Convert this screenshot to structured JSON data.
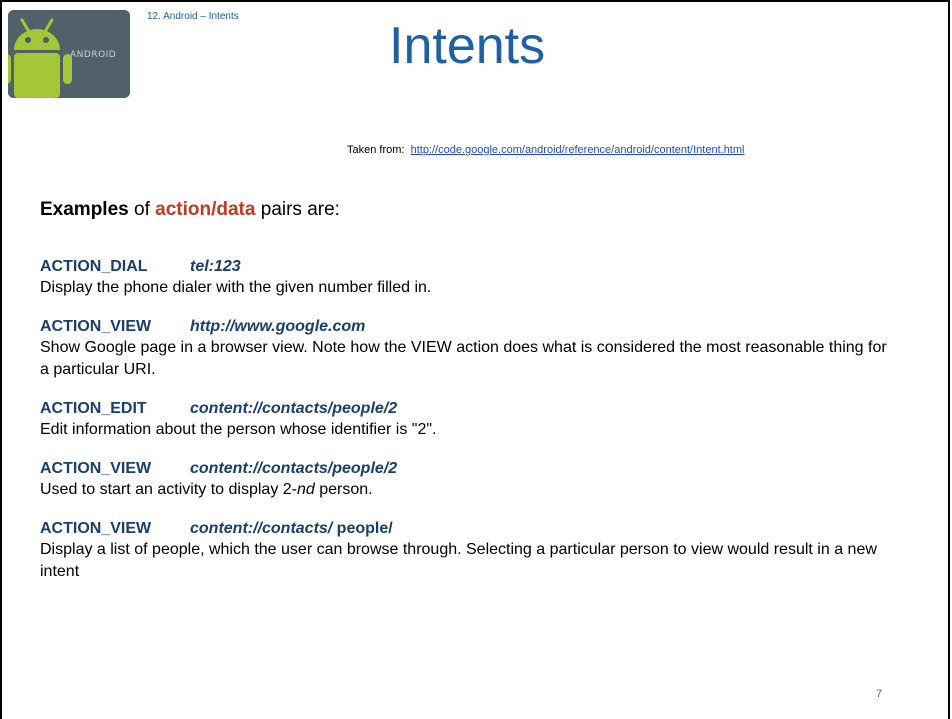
{
  "header": {
    "breadcrumb": "12. Android – Intents",
    "title": "Intents",
    "logo_wordmark": "ANDROID"
  },
  "source": {
    "label": "Taken from:",
    "url": "http://code.google.com/android/reference/android/content/Intent.html"
  },
  "heading": {
    "examples": "Examples",
    "of": "of",
    "accent": "action/data",
    "rest": "pairs are:"
  },
  "entries": [
    {
      "action": "ACTION_DIAL",
      "data": "tel:123",
      "data_extra": "",
      "desc": "Display the phone dialer with the given number filled in."
    },
    {
      "action": "ACTION_VIEW",
      "data": "http://www.google.com",
      "data_extra": "",
      "desc": "Show Google page in a browser view. Note how the VIEW action does what is considered the most reasonable thing for a particular URI."
    },
    {
      "action": "ACTION_EDIT",
      "data": "content://contacts/people/2",
      "data_extra": "",
      "desc": "Edit information about the person whose identifier is \"2\"."
    },
    {
      "action": "ACTION_VIEW",
      "data": "content://contacts/people/2",
      "data_extra": "",
      "desc_a": "Used to start an activity to display 2-",
      "desc_b": "nd",
      "desc_c": " person."
    },
    {
      "action": "ACTION_VIEW",
      "data": "content://contacts/",
      "data_extra": " people/",
      "desc": "Display a list of people, which the user can browse through. Selecting a particular person to view would result in a new intent"
    }
  ],
  "page_number": "7",
  "colors": {
    "title": "#1f5fa8",
    "accent": "#c5391f",
    "entry_head": "#1a3e6e",
    "logo_bg": "#4b5a63",
    "android_green": "#a4c639"
  }
}
